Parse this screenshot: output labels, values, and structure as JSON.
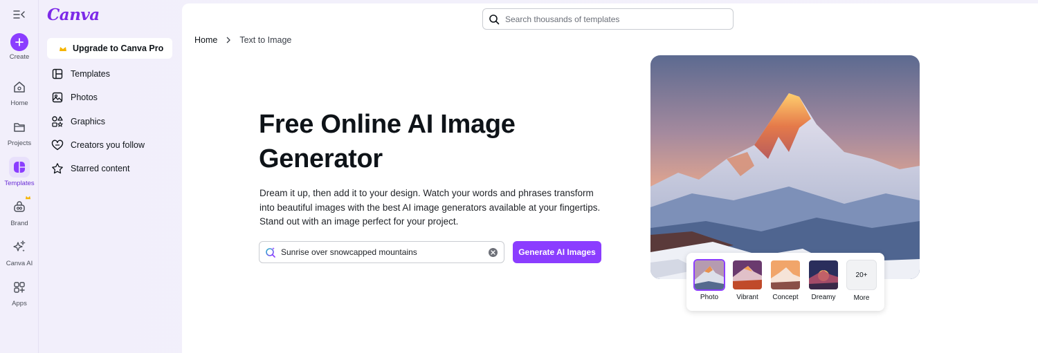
{
  "brand": {
    "logo": "Canva",
    "accent": "#8b3dff",
    "logo_teal": "#22b3c6"
  },
  "rail": {
    "toggle_icon": "sidebar-collapse-icon",
    "items": [
      {
        "label": "Create",
        "icon": "plus-icon"
      },
      {
        "label": "Home",
        "icon": "home-icon"
      },
      {
        "label": "Projects",
        "icon": "folder-icon"
      },
      {
        "label": "Templates",
        "icon": "templates-icon",
        "active": true
      },
      {
        "label": "Brand",
        "icon": "brand-icon",
        "badge": "crown"
      },
      {
        "label": "Canva AI",
        "icon": "sparkle-icon"
      },
      {
        "label": "Apps",
        "icon": "apps-icon"
      }
    ]
  },
  "sidebar": {
    "upgrade_label": "Upgrade to Canva Pro",
    "items": [
      {
        "label": "Templates",
        "icon": "layout-icon"
      },
      {
        "label": "Photos",
        "icon": "image-icon"
      },
      {
        "label": "Graphics",
        "icon": "shapes-icon"
      },
      {
        "label": "Creators you follow",
        "icon": "heart-icon"
      },
      {
        "label": "Starred content",
        "icon": "star-icon"
      }
    ]
  },
  "search": {
    "placeholder": "Search thousands of templates"
  },
  "breadcrumb": {
    "home": "Home",
    "current": "Text to Image"
  },
  "hero": {
    "title_line1": "Free Online AI Image",
    "title_line2": "Generator",
    "description": "Dream it up, then add it to your design. Watch your words and phrases transform into beautiful images with the best AI image generators available at your fingertips. Stand out with an image perfect for your project.",
    "prompt_value": "Sunrise over snowcapped mountains",
    "generate_label": "Generate AI Images"
  },
  "styles": {
    "items": [
      {
        "label": "Photo",
        "selected": true
      },
      {
        "label": "Vibrant"
      },
      {
        "label": "Concept"
      },
      {
        "label": "Dreamy"
      },
      {
        "label": "More",
        "badge": "20+"
      }
    ]
  }
}
